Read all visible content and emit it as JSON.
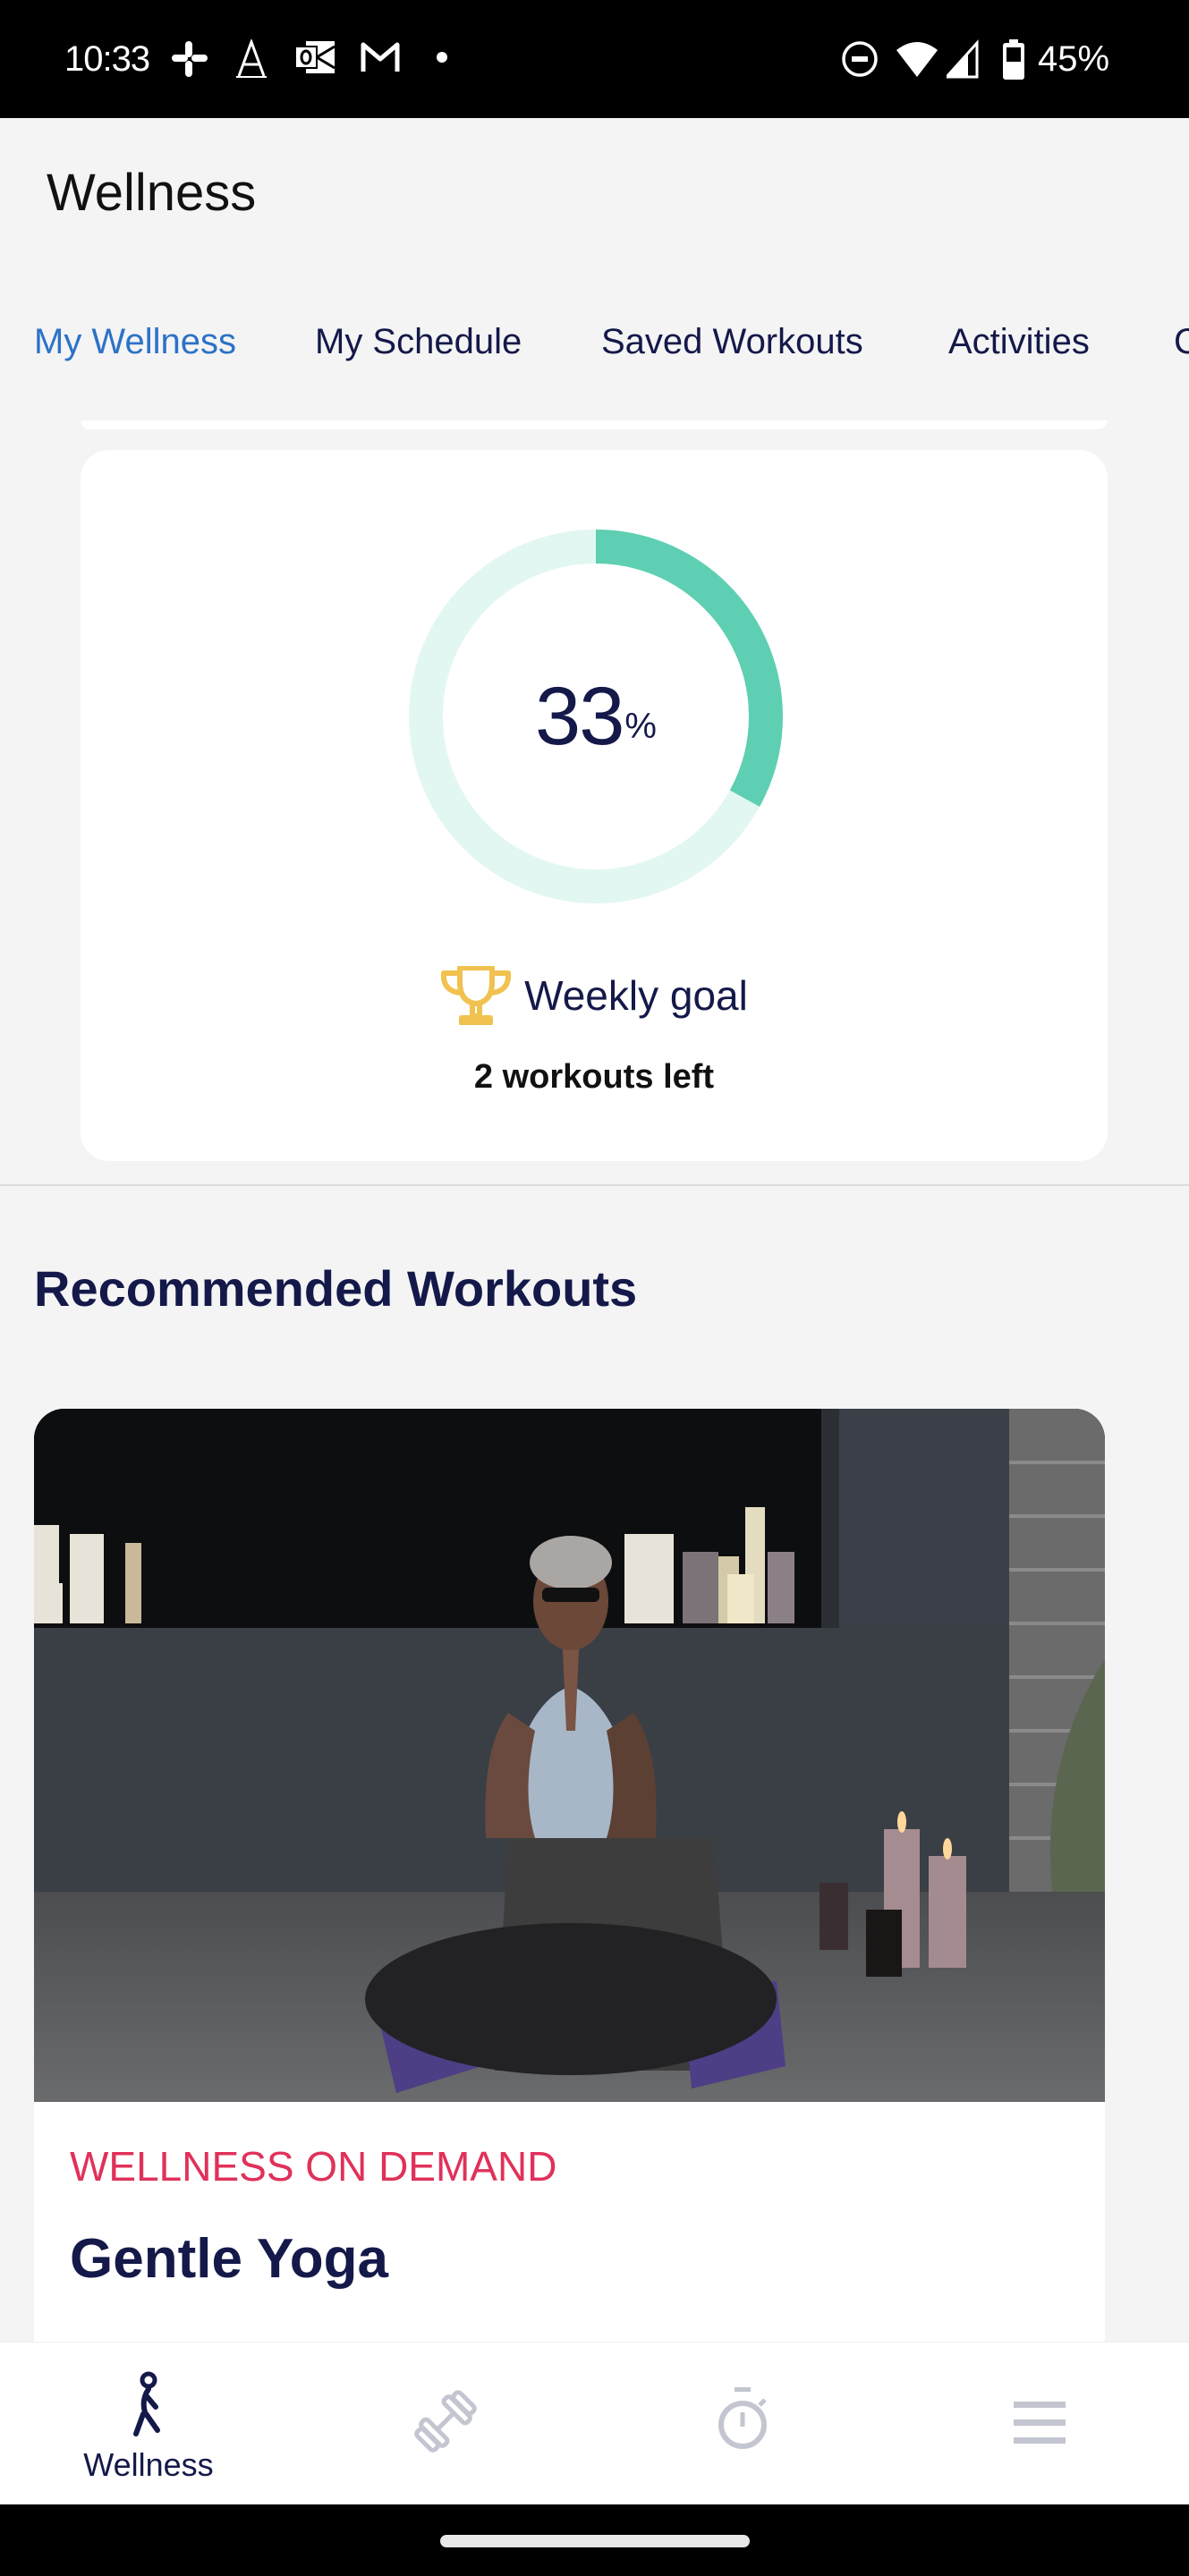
{
  "status_bar": {
    "time": "10:33",
    "notification_icons": [
      "slack-icon",
      "font-a-icon",
      "outlook-icon",
      "gmail-icon",
      "dot-icon"
    ],
    "system_icons": [
      "do-not-disturb-icon",
      "wifi-icon",
      "cell-signal-icon",
      "battery-icon"
    ],
    "battery_percent": "45%"
  },
  "header": {
    "title": "Wellness"
  },
  "tabs": [
    {
      "label": "My Wellness",
      "active": true
    },
    {
      "label": "My Schedule",
      "active": false
    },
    {
      "label": "Saved Workouts",
      "active": false
    },
    {
      "label": "Activities",
      "active": false
    },
    {
      "label": "C",
      "active": false
    }
  ],
  "progress": {
    "value": 33,
    "value_text": "33",
    "unit": "%",
    "fraction": 0.33,
    "track_color": "#e3f7f2",
    "fill_color": "#5ecfb2",
    "goal_label": "Weekly goal",
    "goal_icon": "trophy-icon",
    "goal_icon_color": "#f1c24f",
    "remaining_text": "2 workouts left"
  },
  "recommended": {
    "section_title": "Recommended Workouts",
    "workouts": [
      {
        "category": "WELLNESS ON DEMAND",
        "title": "Gentle Yoga",
        "image_desc": "Woman seated cross-legged in prayer pose on yoga mat with purple blocks, candles in background"
      }
    ]
  },
  "bottom_nav": {
    "items": [
      {
        "label": "Wellness",
        "icon": "walking-person-icon",
        "active": true
      },
      {
        "label": "",
        "icon": "dumbbell-icon",
        "active": false
      },
      {
        "label": "",
        "icon": "stopwatch-icon",
        "active": false
      },
      {
        "label": "",
        "icon": "menu-icon",
        "active": false
      }
    ]
  },
  "colors": {
    "brand_navy": "#14194a",
    "active_tab": "#2c72c7",
    "category_red": "#e0315a",
    "nav_inactive": "#c3c6d0"
  }
}
